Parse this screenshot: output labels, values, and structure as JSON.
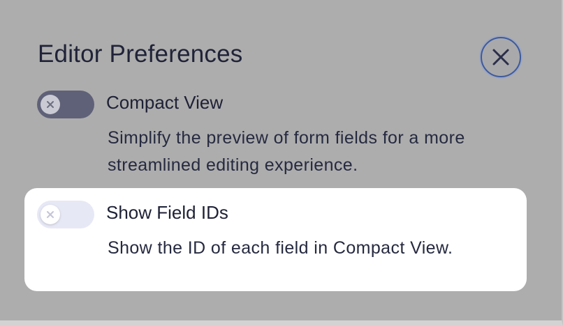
{
  "dialog": {
    "title": "Editor Preferences",
    "close_icon": "close-icon"
  },
  "options": [
    {
      "label": "Compact View",
      "description": "Simplify the preview of form fields for a more streamlined editing experience.",
      "enabled": false,
      "toggle_icon": "x-icon"
    },
    {
      "label": "Show Field IDs",
      "description": "Show the ID of each field in Compact View.",
      "enabled": false,
      "highlighted": true,
      "toggle_icon": "x-icon"
    }
  ],
  "colors": {
    "overlay": "#adadad",
    "highlight_card": "#ffffff",
    "toggle_compact_track": "#5f6178",
    "toggle_fieldids_track": "#e7e8f5",
    "close_ring": "#3d5a9c",
    "text": "#202338"
  }
}
